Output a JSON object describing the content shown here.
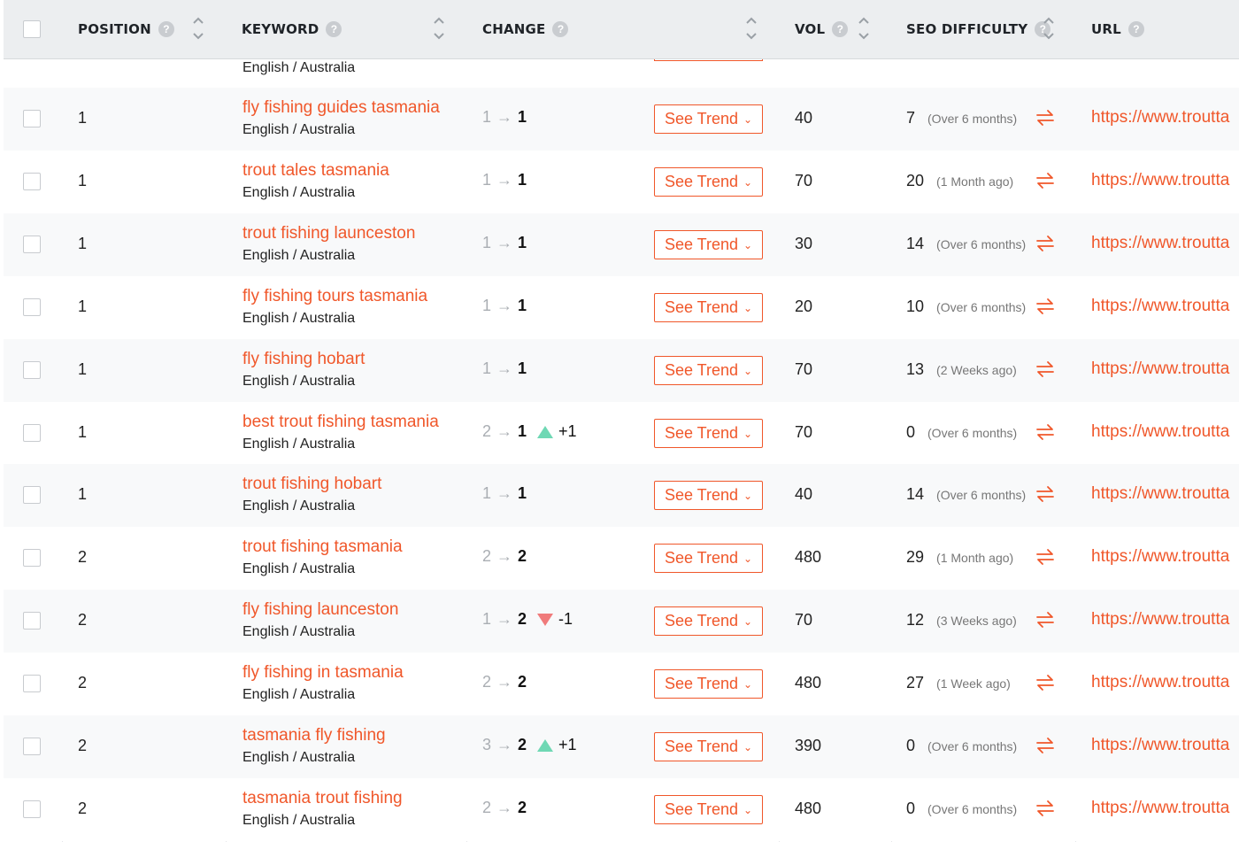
{
  "header": {
    "position": "POSITION",
    "keyword": "KEYWORD",
    "change": "CHANGE",
    "vol": "VOL",
    "seo_difficulty": "SEO DIFFICULTY",
    "url": "URL",
    "help_glyph": "?"
  },
  "partial_row": {
    "location": "English / Australia"
  },
  "trend_label": "See Trend",
  "rows": [
    {
      "position": "1",
      "keyword": "fly fishing guides tasmania",
      "location": "English / Australia",
      "from": "1",
      "to": "1",
      "delta": "",
      "dir": "none",
      "vol": "40",
      "seo": "7",
      "age": "(Over 6 months)",
      "url": "https://www.troutta"
    },
    {
      "position": "1",
      "keyword": "trout tales tasmania",
      "location": "English / Australia",
      "from": "1",
      "to": "1",
      "delta": "",
      "dir": "none",
      "vol": "70",
      "seo": "20",
      "age": "(1 Month ago)",
      "url": "https://www.troutta"
    },
    {
      "position": "1",
      "keyword": "trout fishing launceston",
      "location": "English / Australia",
      "from": "1",
      "to": "1",
      "delta": "",
      "dir": "none",
      "vol": "30",
      "seo": "14",
      "age": "(Over 6 months)",
      "url": "https://www.troutta"
    },
    {
      "position": "1",
      "keyword": "fly fishing tours tasmania",
      "location": "English / Australia",
      "from": "1",
      "to": "1",
      "delta": "",
      "dir": "none",
      "vol": "20",
      "seo": "10",
      "age": "(Over 6 months)",
      "url": "https://www.troutta"
    },
    {
      "position": "1",
      "keyword": "fly fishing hobart",
      "location": "English / Australia",
      "from": "1",
      "to": "1",
      "delta": "",
      "dir": "none",
      "vol": "70",
      "seo": "13",
      "age": "(2 Weeks ago)",
      "url": "https://www.troutta"
    },
    {
      "position": "1",
      "keyword": "best trout fishing tasmania",
      "location": "English / Australia",
      "from": "2",
      "to": "1",
      "delta": "+1",
      "dir": "up",
      "vol": "70",
      "seo": "0",
      "age": "(Over 6 months)",
      "url": "https://www.troutta"
    },
    {
      "position": "1",
      "keyword": "trout fishing hobart",
      "location": "English / Australia",
      "from": "1",
      "to": "1",
      "delta": "",
      "dir": "none",
      "vol": "40",
      "seo": "14",
      "age": "(Over 6 months)",
      "url": "https://www.troutta"
    },
    {
      "position": "2",
      "keyword": "trout fishing tasmania",
      "location": "English / Australia",
      "from": "2",
      "to": "2",
      "delta": "",
      "dir": "none",
      "vol": "480",
      "seo": "29",
      "age": "(1 Month ago)",
      "url": "https://www.troutta"
    },
    {
      "position": "2",
      "keyword": "fly fishing launceston",
      "location": "English / Australia",
      "from": "1",
      "to": "2",
      "delta": "-1",
      "dir": "down",
      "vol": "70",
      "seo": "12",
      "age": "(3 Weeks ago)",
      "url": "https://www.troutta"
    },
    {
      "position": "2",
      "keyword": "fly fishing in tasmania",
      "location": "English / Australia",
      "from": "2",
      "to": "2",
      "delta": "",
      "dir": "none",
      "vol": "480",
      "seo": "27",
      "age": "(1 Week ago)",
      "url": "https://www.troutta"
    },
    {
      "position": "2",
      "keyword": "tasmania fly fishing",
      "location": "English / Australia",
      "from": "3",
      "to": "2",
      "delta": "+1",
      "dir": "up",
      "vol": "390",
      "seo": "0",
      "age": "(Over 6 months)",
      "url": "https://www.troutta"
    },
    {
      "position": "2",
      "keyword": "tasmania trout fishing",
      "location": "English / Australia",
      "from": "2",
      "to": "2",
      "delta": "",
      "dir": "none",
      "vol": "480",
      "seo": "0",
      "age": "(Over 6 months)",
      "url": "https://www.troutta"
    }
  ],
  "colors": {
    "accent": "#f0572a",
    "up": "#6fd8b4",
    "down": "#f07b7b",
    "header_bg": "#eceef0"
  }
}
